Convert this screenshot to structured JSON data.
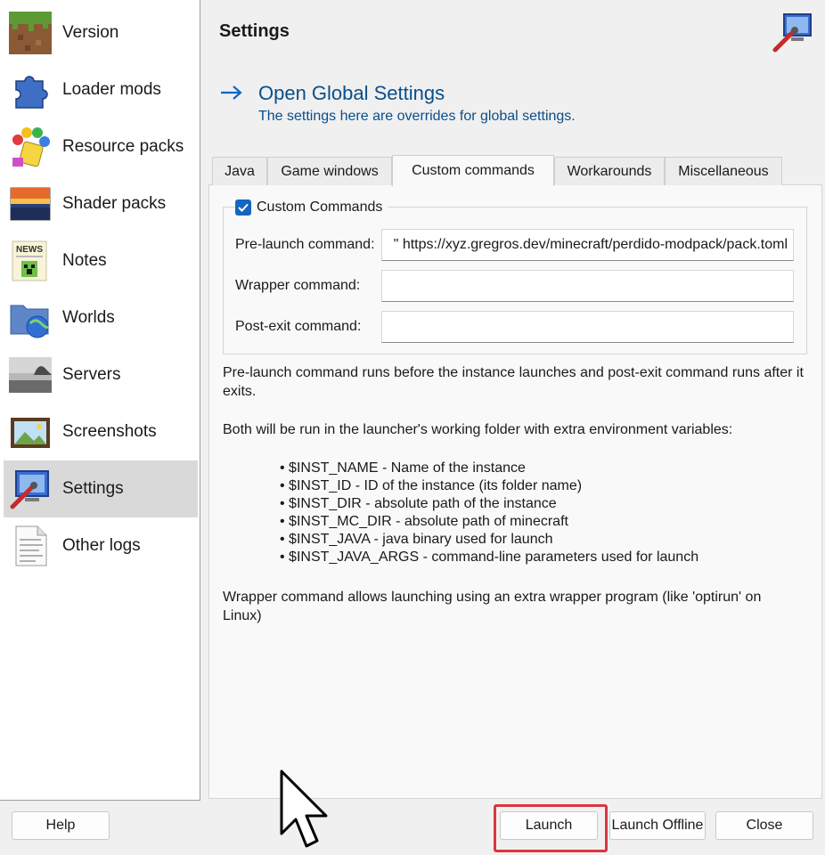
{
  "sidebar": {
    "items": [
      {
        "label": "Version",
        "icon": "grass-block-icon"
      },
      {
        "label": "Loader mods",
        "icon": "puzzle-piece-icon"
      },
      {
        "label": "Resource packs",
        "icon": "paint-bucket-icon"
      },
      {
        "label": "Shader packs",
        "icon": "sunset-landscape-icon"
      },
      {
        "label": "Notes",
        "icon": "news-note-icon"
      },
      {
        "label": "Worlds",
        "icon": "globe-folder-icon"
      },
      {
        "label": "Servers",
        "icon": "server-landscape-icon"
      },
      {
        "label": "Screenshots",
        "icon": "framed-picture-icon"
      },
      {
        "label": "Settings",
        "icon": "settings-computer-icon",
        "selected": true
      },
      {
        "label": "Other logs",
        "icon": "log-document-icon"
      }
    ]
  },
  "header": {
    "title": "Settings",
    "icon": "settings-computer-icon"
  },
  "global_link": {
    "title": "Open Global Settings",
    "subtitle": "The settings here are overrides for global settings.",
    "icon": "arrow-right-icon"
  },
  "tabs": [
    {
      "label": "Java"
    },
    {
      "label": "Game windows"
    },
    {
      "label": "Custom commands",
      "active": true
    },
    {
      "label": "Workarounds"
    },
    {
      "label": "Miscellaneous"
    }
  ],
  "custom_commands": {
    "group_label": "Custom Commands",
    "checked": true,
    "pre_launch_label": "Pre-launch command:",
    "pre_launch_value": "\" https://xyz.gregros.dev/minecraft/perdido-modpack/pack.toml",
    "wrapper_label": "Wrapper command:",
    "wrapper_value": "",
    "post_exit_label": "Post-exit command:",
    "post_exit_value": ""
  },
  "help": {
    "para1": "Pre-launch command runs before the instance launches and post-exit command runs after it exits.",
    "para2": "Both will be run in the launcher's working folder with extra environment variables:",
    "bullets": [
      "• $INST_NAME - Name of the instance",
      "• $INST_ID - ID of the instance (its folder name)",
      "• $INST_DIR - absolute path of the instance",
      "• $INST_MC_DIR - absolute path of minecraft",
      "• $INST_JAVA - java binary used for launch",
      "• $INST_JAVA_ARGS - command-line parameters used for launch"
    ],
    "para3": "Wrapper command allows launching using an extra wrapper program (like 'optirun' on Linux)"
  },
  "buttons": {
    "help": "Help",
    "launch": "Launch",
    "launch_offline": "Launch Offline",
    "close": "Close"
  },
  "colors": {
    "accent": "#1565c0",
    "link": "#0a4e8a",
    "highlight": "#d9363e"
  }
}
